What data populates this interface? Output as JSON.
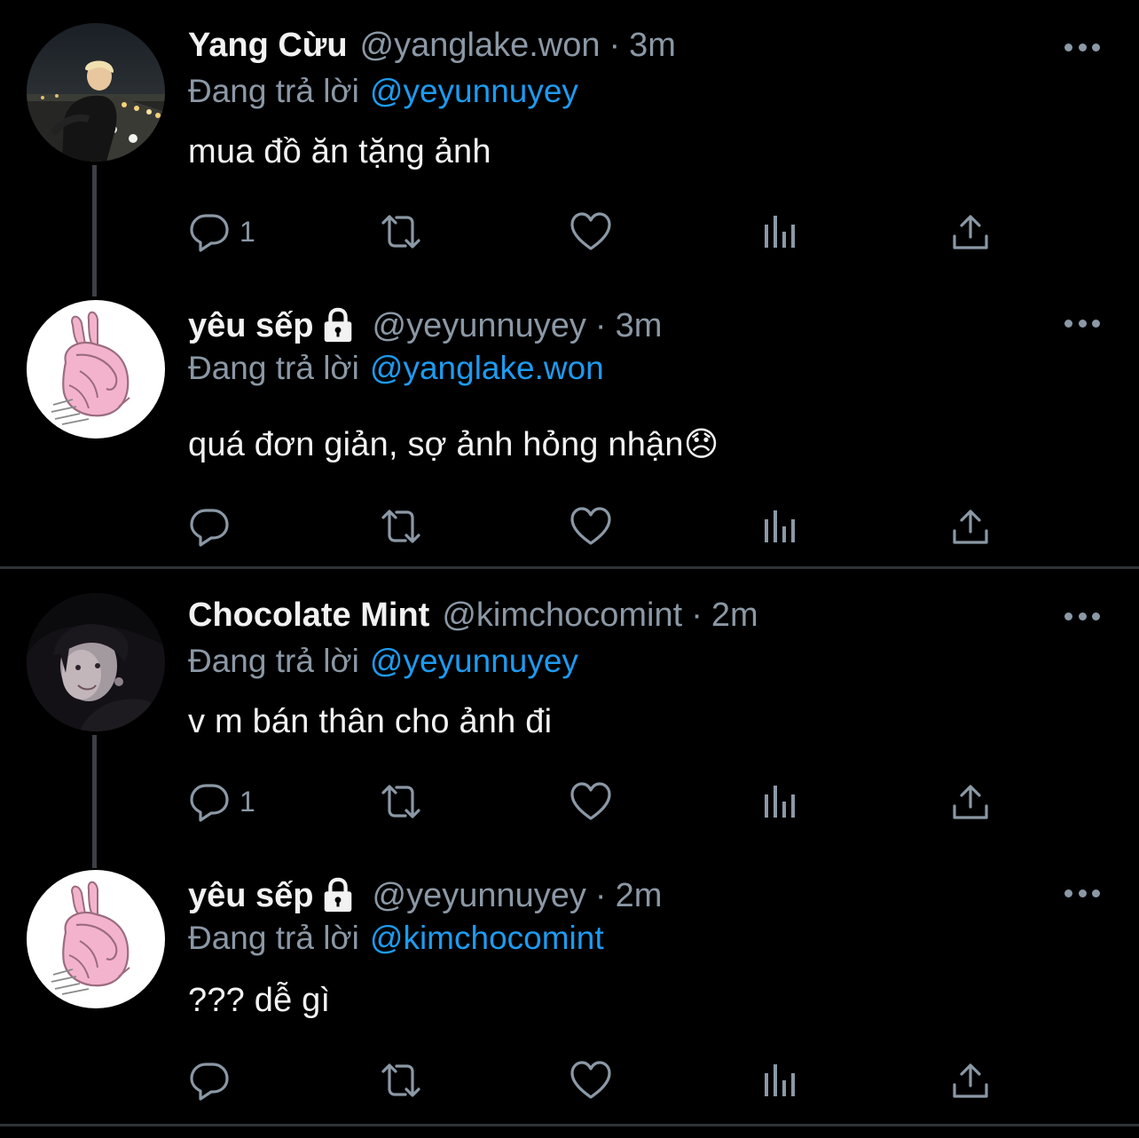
{
  "reply_prefix": "Đang trả lời",
  "colors": {
    "background": "#000000",
    "link": "#1d9bf0",
    "muted": "#8b98a5",
    "text": "#f2f2f2"
  },
  "tweets": [
    {
      "name": "Yang Cừu",
      "handle": "@yanglake.won",
      "separator": "·",
      "time": "3m",
      "reply_to": "@yeyunnuyey",
      "text": "mua đồ ăn tặng ảnh",
      "reply_count": "1",
      "protected": false,
      "avatar": "night-city-photo"
    },
    {
      "name": "yêu sếp",
      "handle": "@yeyunnuyey",
      "separator": "·",
      "time": "3m",
      "reply_to": "@yanglake.won",
      "text": "quá đơn giản, sợ ảnh hỏng nhận😞",
      "reply_count": "",
      "protected": true,
      "avatar": "pink-rabbit-drawing"
    },
    {
      "name": "Chocolate Mint",
      "handle": "@kimchocomint",
      "separator": "·",
      "time": "2m",
      "reply_to": "@yeyunnuyey",
      "text": "v m bán thân cho ảnh đi",
      "reply_count": "1",
      "protected": false,
      "avatar": "dark-portrait-photo"
    },
    {
      "name": "yêu sếp",
      "handle": "@yeyunnuyey",
      "separator": "·",
      "time": "2m",
      "reply_to": "@kimchocomint",
      "text": "??? dễ gì",
      "reply_count": "",
      "protected": true,
      "avatar": "pink-rabbit-drawing"
    }
  ],
  "action_icons": [
    "reply-icon",
    "retweet-icon",
    "like-icon",
    "views-icon",
    "share-icon"
  ]
}
